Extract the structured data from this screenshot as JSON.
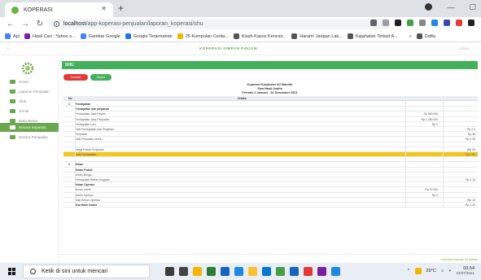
{
  "browser": {
    "tab_title": "KOPERASI",
    "new_tab": "+",
    "url_host": "localhost",
    "url_path": "/app-koperasi-penjualan/laporan_koperasi/shu",
    "bookmarks": [
      {
        "label": "Apl",
        "color": "#4285f4"
      },
      {
        "label": "Hasil Cari : Yahoo s...",
        "color": "#7b1fa2"
      },
      {
        "label": "Gambar Google",
        "color": "#4285f4"
      },
      {
        "label": "Google Terjemahan",
        "color": "#1a73e8"
      },
      {
        "label": "25 Kumpulan Cerita...",
        "color": "#f4b400"
      },
      {
        "label": "Kisah Kasus Kencan...",
        "color": "#555555"
      },
      {
        "label": "Haram! Jangan Lak...",
        "color": "#555555"
      },
      {
        "label": "Kajahatan Terkait A...",
        "color": "#555555"
      },
      {
        "label": "Dafta",
        "color": "#555555"
      }
    ],
    "overflow": "»"
  },
  "app": {
    "title": "KOPERASI SIMPAN PINJAM",
    "user": "Admin",
    "sidebar": [
      {
        "label": "Home",
        "active": false
      },
      {
        "label": "Laporan Penjualan",
        "active": false
      },
      {
        "label": "Stok",
        "active": false
      },
      {
        "label": "Jurnal",
        "active": false
      },
      {
        "label": "Buku Besar",
        "active": false
      },
      {
        "label": "Neraca Koperasi",
        "active": true
      },
      {
        "label": "Neraca Penjualan",
        "active": false
      }
    ],
    "panel_title": "SHU",
    "btn_back": "Kembali",
    "btn_export": "Export"
  },
  "report": {
    "title1": "Koperasi Karyawan Sri Mandiri",
    "title2": "Sisa Hasil Usaha",
    "title3": "Periode 1 Januari - 31 Desember 2021",
    "col_no": "No",
    "col_uraian": "Uraian",
    "rows": [
      {
        "label": "Pendapatan",
        "no": "1",
        "bold": true,
        "v1": "",
        "v2": ""
      },
      {
        "label": "Pendapatan dari pinjaman",
        "no": "",
        "bold": true,
        "v1": "",
        "v2": ""
      },
      {
        "label": "Pendapatan Jasa Pinjam",
        "no": "",
        "bold": false,
        "v1": "Rp 350.000",
        "v2": ""
      },
      {
        "label": "Pendapatan Jasa Penjualan",
        "no": "",
        "bold": false,
        "v1": "Rp 1.450.000",
        "v2": ""
      },
      {
        "label": "Pendapatan Lain",
        "no": "",
        "bold": false,
        "v1": "Rp 0",
        "v2": ""
      },
      {
        "label": "Total Pendapatan dari Pinjaman",
        "no": "",
        "bold": false,
        "v1": "",
        "v2": "Rp 2.0"
      },
      {
        "label": "Penjualan",
        "no": "",
        "bold": false,
        "v1": "",
        "v2": "Rp 35"
      },
      {
        "label": "Total Penjualan bersih",
        "no": "",
        "bold": false,
        "v1": "",
        "v2": "Rp 2.35"
      },
      {
        "label": "",
        "no": "",
        "bold": false,
        "v1": "",
        "v2": ""
      },
      {
        "label": "Harga Pokok Penjualan",
        "no": "",
        "bold": false,
        "v1": "",
        "v2": "(Rp 95"
      },
      {
        "label": "Total Pendapatan",
        "no": "",
        "bold": false,
        "v1": "",
        "v2": "Rp 2.55",
        "highlight": true
      },
      {
        "label": "",
        "no": "",
        "bold": false,
        "v1": "",
        "v2": ""
      },
      {
        "label": "Beban",
        "no": "2",
        "bold": true,
        "v1": "",
        "v2": ""
      },
      {
        "label": "Beban Pokok",
        "no": "",
        "bold": true,
        "v1": "",
        "v2": ""
      },
      {
        "label": "Beban Bunga",
        "no": "",
        "bold": false,
        "v1": "",
        "v2": ""
      },
      {
        "label": "Pendapatan Beban Anggota",
        "no": "",
        "bold": false,
        "v1": "",
        "v2": "Rp 2.15"
      },
      {
        "label": "Beban Operasi",
        "no": "",
        "bold": true,
        "v1": "",
        "v2": ""
      },
      {
        "label": "Beban Listrik",
        "no": "",
        "bold": false,
        "v1": "Rp 70.000",
        "v2": ""
      },
      {
        "label": "Beban Operasi",
        "no": "",
        "bold": false,
        "v1": "Rp 0",
        "v2": ""
      },
      {
        "label": "Total Beban Operasi",
        "no": "",
        "bold": false,
        "v1": "",
        "v2": "(Rp 10"
      },
      {
        "label": "Sisa Hasil Usaha",
        "no": "",
        "bold": true,
        "v1": "",
        "v2": "Rp 2.25"
      }
    ],
    "copyright": "Copyright Koperasi Sri Mandiri"
  },
  "taskbar": {
    "search_placeholder": "Ketik di sini untuk mencari",
    "weather": "20°C",
    "time": "03.54",
    "date": "22/07/2021",
    "app_colors": [
      "#3c3c3c",
      "#444",
      "#f4b400",
      "#2e7d32",
      "#1565c0",
      "#1e88e5",
      "#fbc02d",
      "#0078d4",
      "#43a047",
      "#1565c0",
      "#e53935",
      "#7b1fa2",
      "#1e88e5"
    ]
  }
}
